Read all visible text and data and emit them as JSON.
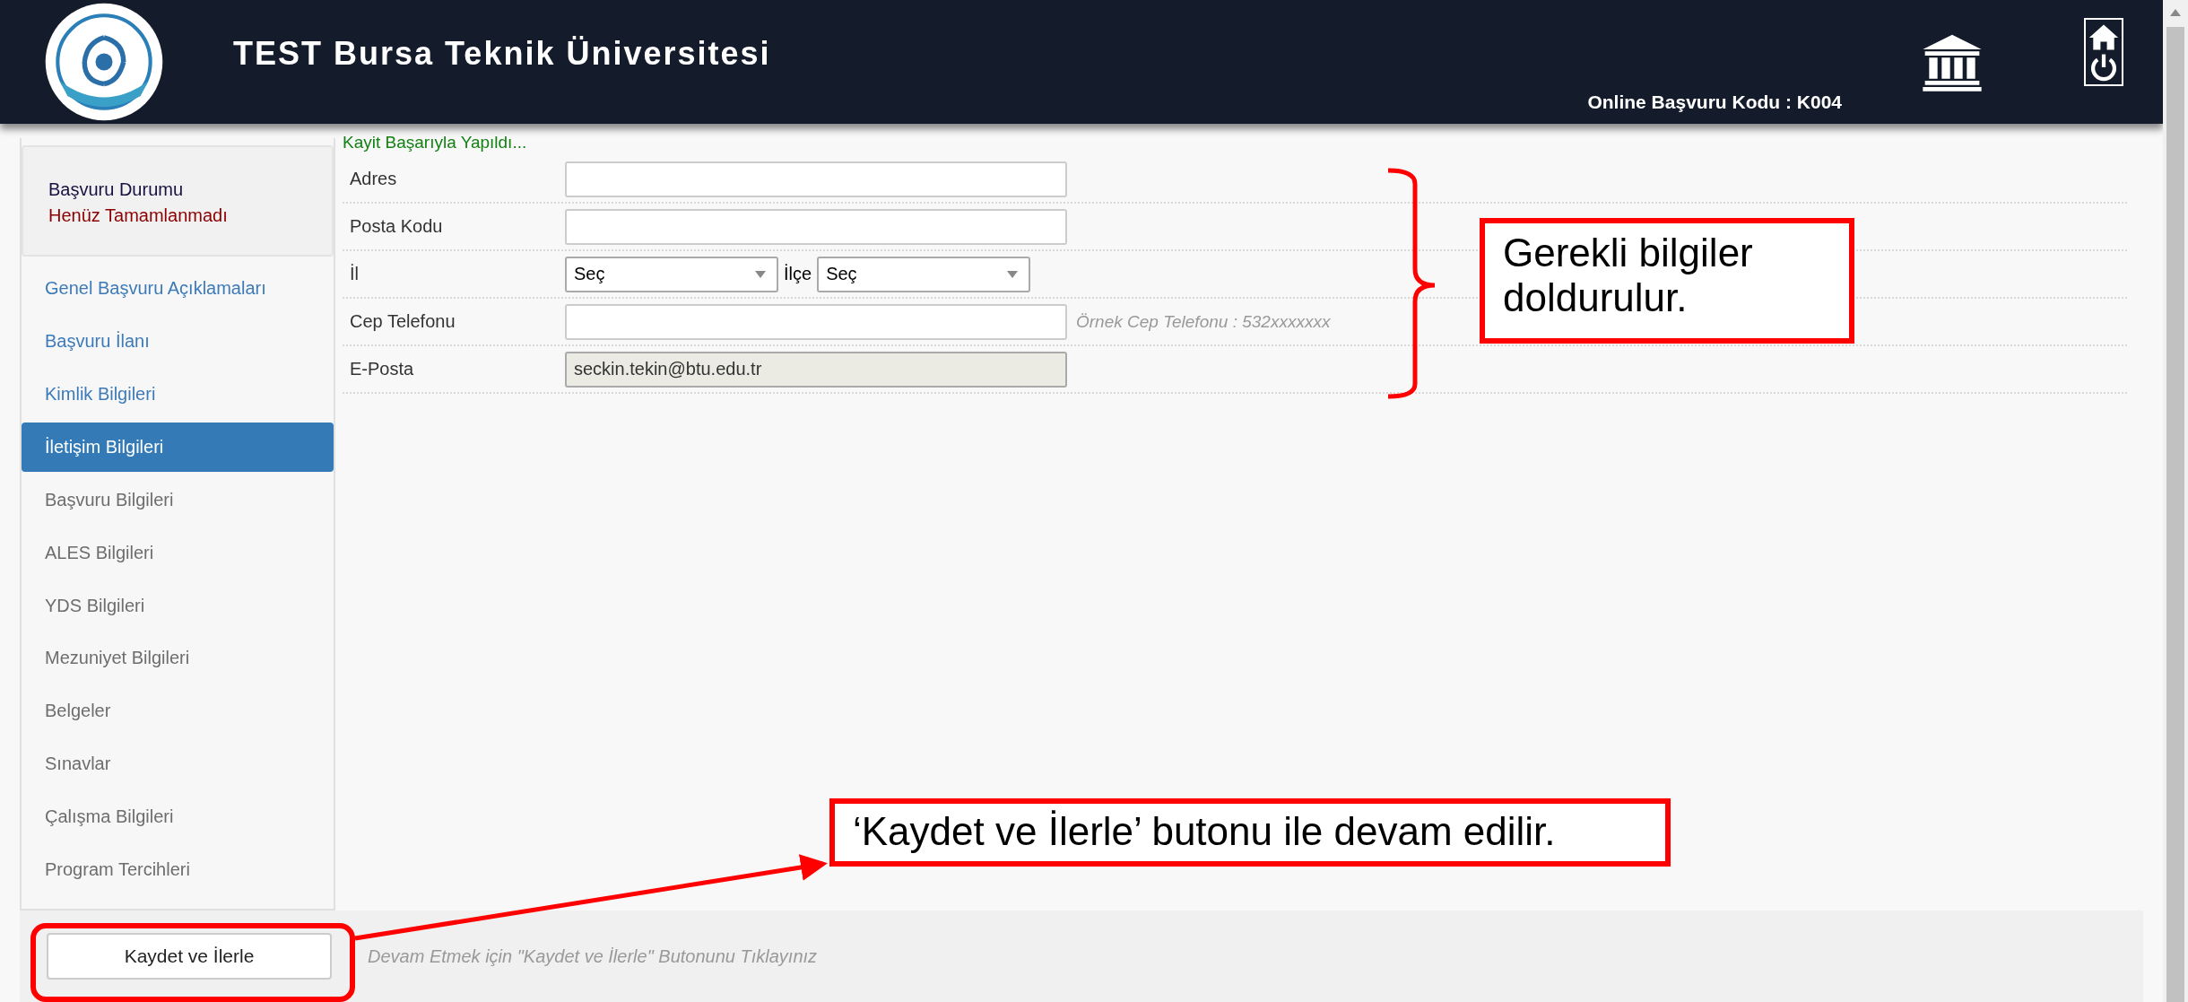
{
  "header": {
    "title": "TEST Bursa Teknik Üniversitesi",
    "application_code": "Online Başvuru Kodu : K004"
  },
  "sidebar": {
    "status_label": "Başvuru Durumu",
    "status_value": "Henüz Tamamlanmadı",
    "items": [
      {
        "label": "Genel Başvuru Açıklamaları",
        "selected": false,
        "disabled": false
      },
      {
        "label": "Başvuru İlanı",
        "selected": false,
        "disabled": false
      },
      {
        "label": "Kimlik Bilgileri",
        "selected": false,
        "disabled": false
      },
      {
        "label": "İletişim Bilgileri",
        "selected": true,
        "disabled": false
      },
      {
        "label": "Başvuru Bilgileri",
        "selected": false,
        "disabled": true
      },
      {
        "label": "ALES Bilgileri",
        "selected": false,
        "disabled": true
      },
      {
        "label": "YDS Bilgileri",
        "selected": false,
        "disabled": true
      },
      {
        "label": "Mezuniyet Bilgileri",
        "selected": false,
        "disabled": true
      },
      {
        "label": "Belgeler",
        "selected": false,
        "disabled": true
      },
      {
        "label": "Sınavlar",
        "selected": false,
        "disabled": true
      },
      {
        "label": "Çalışma Bilgileri",
        "selected": false,
        "disabled": true
      },
      {
        "label": "Program Tercihleri",
        "selected": false,
        "disabled": true
      }
    ]
  },
  "form": {
    "message": "Kayit Başarıyla Yapıldı...",
    "rows": [
      {
        "kind": "text",
        "label": "Adres",
        "disabled": false
      },
      {
        "kind": "text",
        "label": "Posta Kodu",
        "disabled": false
      },
      {
        "kind": "select-pair",
        "label": "İl",
        "value": "Seç",
        "second_label": "İlçe",
        "second_value": "Seç"
      },
      {
        "kind": "text",
        "label": "Cep Telefonu",
        "hint": "Örnek Cep Telefonu : 532xxxxxxx",
        "disabled": false
      },
      {
        "kind": "text",
        "label": "E-Posta",
        "value": "seckin.tekin@btu.edu.tr",
        "disabled": true
      }
    ]
  },
  "footer": {
    "button": "Kaydet ve İlerle",
    "hint": "Devam Etmek için \"Kaydet ve İlerle\" Butonunu Tıklayınız"
  },
  "annotations": [
    {
      "text": "Gerekli bilgiler doldurulur."
    },
    {
      "text": "‘Kaydet ve İlerle’ butonu ile devam edilir."
    }
  ]
}
